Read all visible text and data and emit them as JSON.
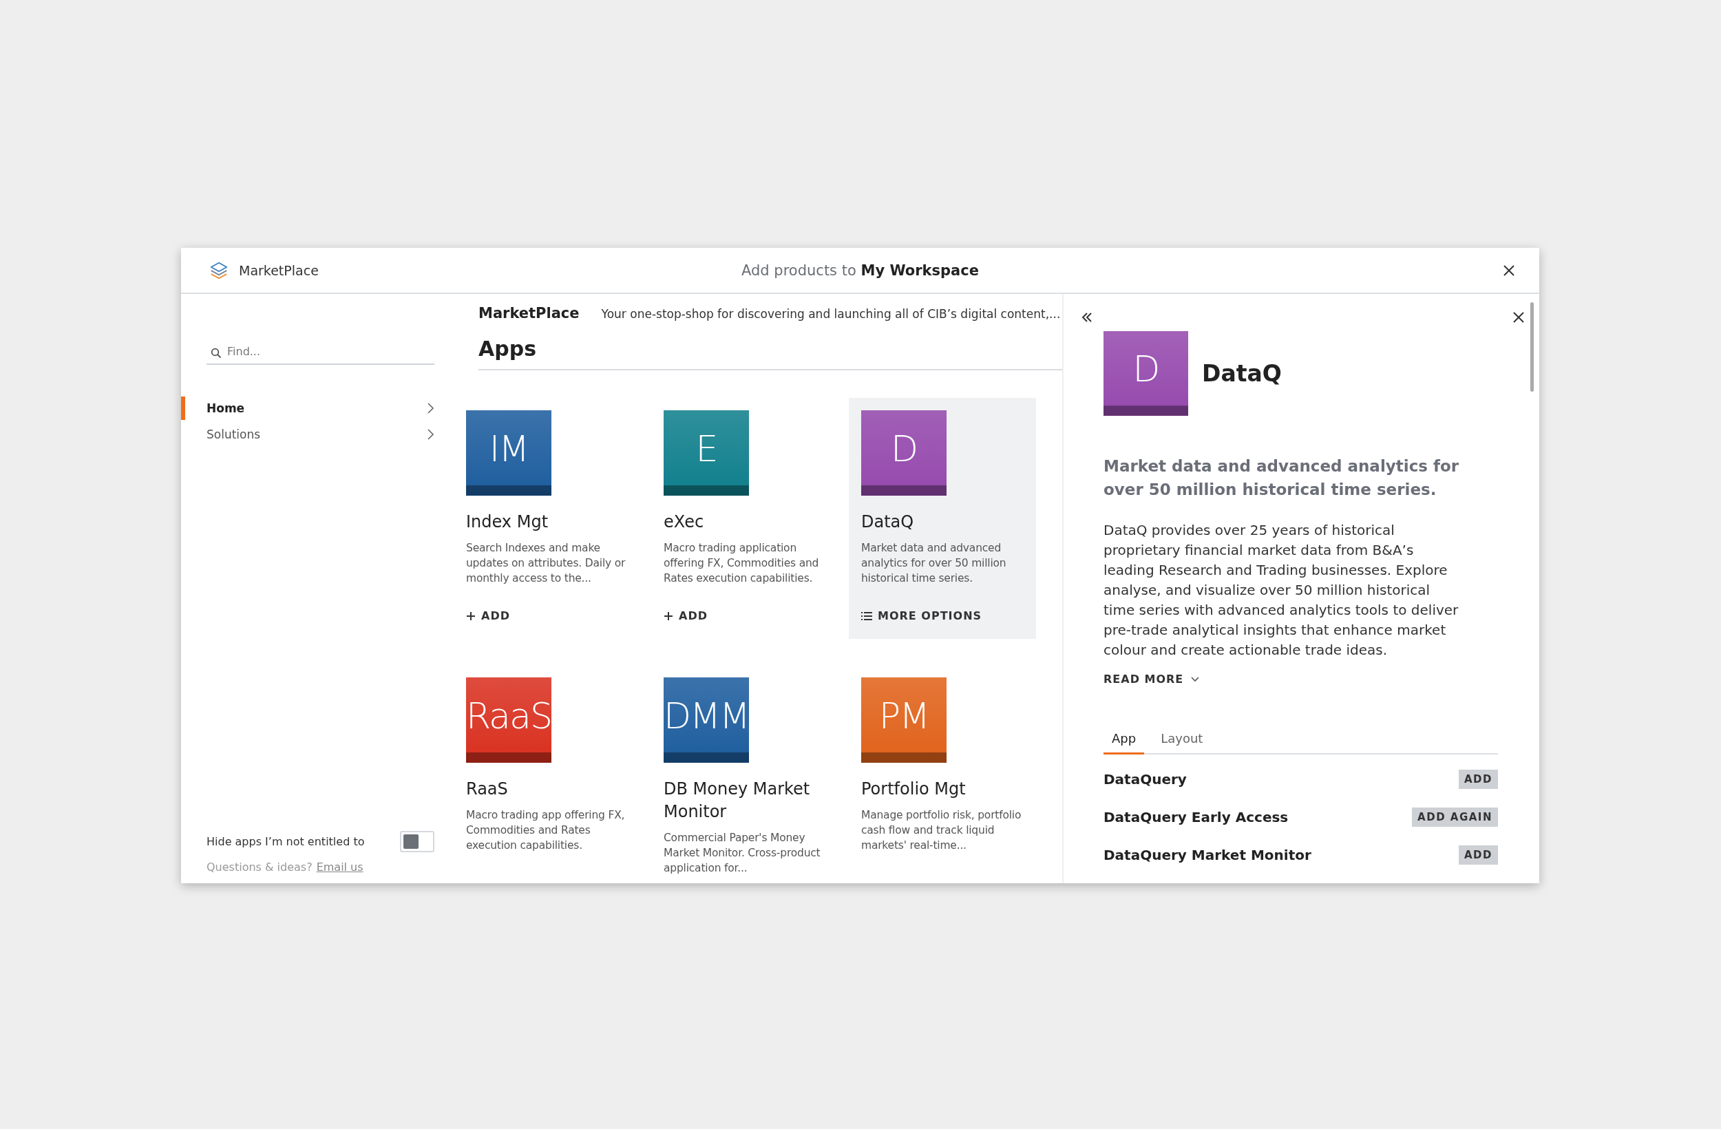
{
  "header": {
    "app_name": "MarketPlace",
    "title_prefix": "Add products to",
    "title_bold": "My Workspace"
  },
  "sidebar": {
    "search": {
      "placeholder": "Find..."
    },
    "nav": [
      {
        "label": "Home",
        "selected": true
      },
      {
        "label": "Solutions",
        "selected": false
      }
    ],
    "hide_toggle": {
      "label": "Hide apps I’m not entitled to",
      "on": false
    },
    "footer": {
      "text": "Questions & ideas?",
      "link": "Email us"
    }
  },
  "main": {
    "brand": "MarketPlace",
    "tagline": "Your one-stop-shop for discovering and launching all of CIB’s digital content,...",
    "section_title": "Apps",
    "apps": [
      {
        "initials": "IM",
        "name": "Index Mgt",
        "description": "Search Indexes and make updates on attributes. Daily or monthly access to the...",
        "color": "#1d5d9e",
        "selected": false,
        "action": {
          "kind": "add",
          "label": "ADD"
        }
      },
      {
        "initials": "E",
        "name": "eXec",
        "description": "Macro trading application offering FX, Commodities and Rates execution capabilities.",
        "color": "#0f7f8c",
        "selected": false,
        "action": {
          "kind": "add",
          "label": "ADD"
        }
      },
      {
        "initials": "D",
        "name": "DataQ",
        "description": "Market data and advanced analytics for over 50 million historical time series.",
        "color": "#9549ad",
        "selected": true,
        "action": {
          "kind": "options",
          "label": "MORE OPTIONS"
        }
      },
      {
        "initials": "RaaS",
        "name": "RaaS",
        "description": "Macro trading app offering FX, Commodities and Rates execution capabilities.",
        "color": "#d9301f"
      },
      {
        "initials": "DMM",
        "name": "DB Money Market Monitor",
        "description": "Commercial Paper's Money Market Monitor. Cross-product application for...",
        "color": "#1d5d9e"
      },
      {
        "initials": "PM",
        "name": "Portfolio Mgt",
        "description": "Manage portfolio risk, portfolio cash flow and track liquid markets' real-time...",
        "color": "#e0621a"
      }
    ]
  },
  "detail": {
    "initials": "D",
    "color": "#9549ad",
    "name": "DataQ",
    "headline": "Market data and advanced analytics for over 50 million historical time series.",
    "body": "DataQ provides over 25 years of historical proprietary financial market data from B&A’s leading Research and Trading businesses. Explore analyse, and visualize over 50 million historical time series with advanced analytics tools to deliver pre-trade analytical insights that enhance market colour and create actionable trade ideas.",
    "read_more": "READ MORE",
    "tabs": [
      {
        "label": "App",
        "selected": true
      },
      {
        "label": "Layout",
        "selected": false
      }
    ],
    "items": [
      {
        "name": "DataQuery",
        "action": "ADD"
      },
      {
        "name": "DataQuery Early Access",
        "action": "ADD AGAIN"
      },
      {
        "name": "DataQuery Market Monitor",
        "action": "ADD"
      }
    ]
  }
}
